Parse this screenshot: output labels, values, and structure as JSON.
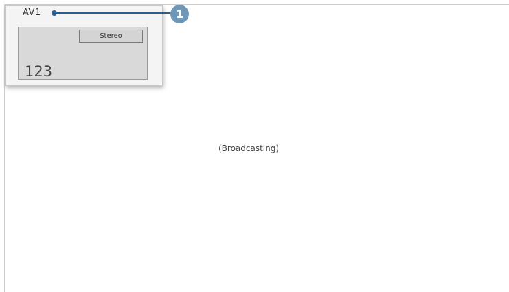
{
  "osd": {
    "source": "AV1",
    "audio_mode": "Stereo",
    "channel": "123"
  },
  "callout": {
    "number": "1",
    "color": "#2b5d8f",
    "badge_color": "#6f98b8"
  },
  "screen": {
    "status": "(Broadcasting)"
  }
}
